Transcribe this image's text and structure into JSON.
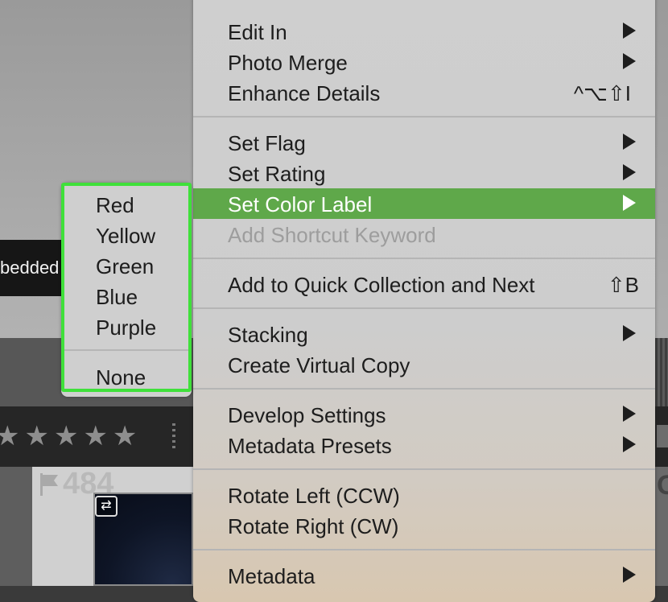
{
  "background": {
    "badge_text": "bedded",
    "thumbnail_number": "484",
    "rating_stars": "★★★★★",
    "right_edge_glyph": "G"
  },
  "menu": {
    "items": [
      {
        "label": "Edit In",
        "submenu": true
      },
      {
        "label": "Photo Merge",
        "submenu": true
      },
      {
        "label": "Enhance Details",
        "shortcut": "^⌥⇧I"
      },
      {
        "label": "Set Flag",
        "submenu": true
      },
      {
        "label": "Set Rating",
        "submenu": true
      },
      {
        "label": "Set Color Label",
        "submenu": true,
        "highlighted": true
      },
      {
        "label": "Add Shortcut Keyword",
        "disabled": true
      },
      {
        "label": "Add to Quick Collection and Next",
        "shortcut": "⇧B"
      },
      {
        "label": "Stacking",
        "submenu": true
      },
      {
        "label": "Create Virtual Copy"
      },
      {
        "label": "Develop Settings",
        "submenu": true
      },
      {
        "label": "Metadata Presets",
        "submenu": true
      },
      {
        "label": "Rotate Left (CCW)"
      },
      {
        "label": "Rotate Right (CW)"
      },
      {
        "label": "Metadata",
        "submenu": true
      }
    ]
  },
  "color_label_submenu": {
    "items": [
      "Red",
      "Yellow",
      "Green",
      "Blue",
      "Purple",
      "None"
    ]
  },
  "colors": {
    "highlight": "#5fa84a",
    "submenu_outline": "#3fe03a",
    "menu_background": "#cfcfcf",
    "disabled_text": "#9d9d9d"
  },
  "icons": {
    "submenu_arrow": "chevron-right-icon",
    "thumbnail_flag": "flag-icon",
    "thumbnail_badge": "swap-icon"
  }
}
